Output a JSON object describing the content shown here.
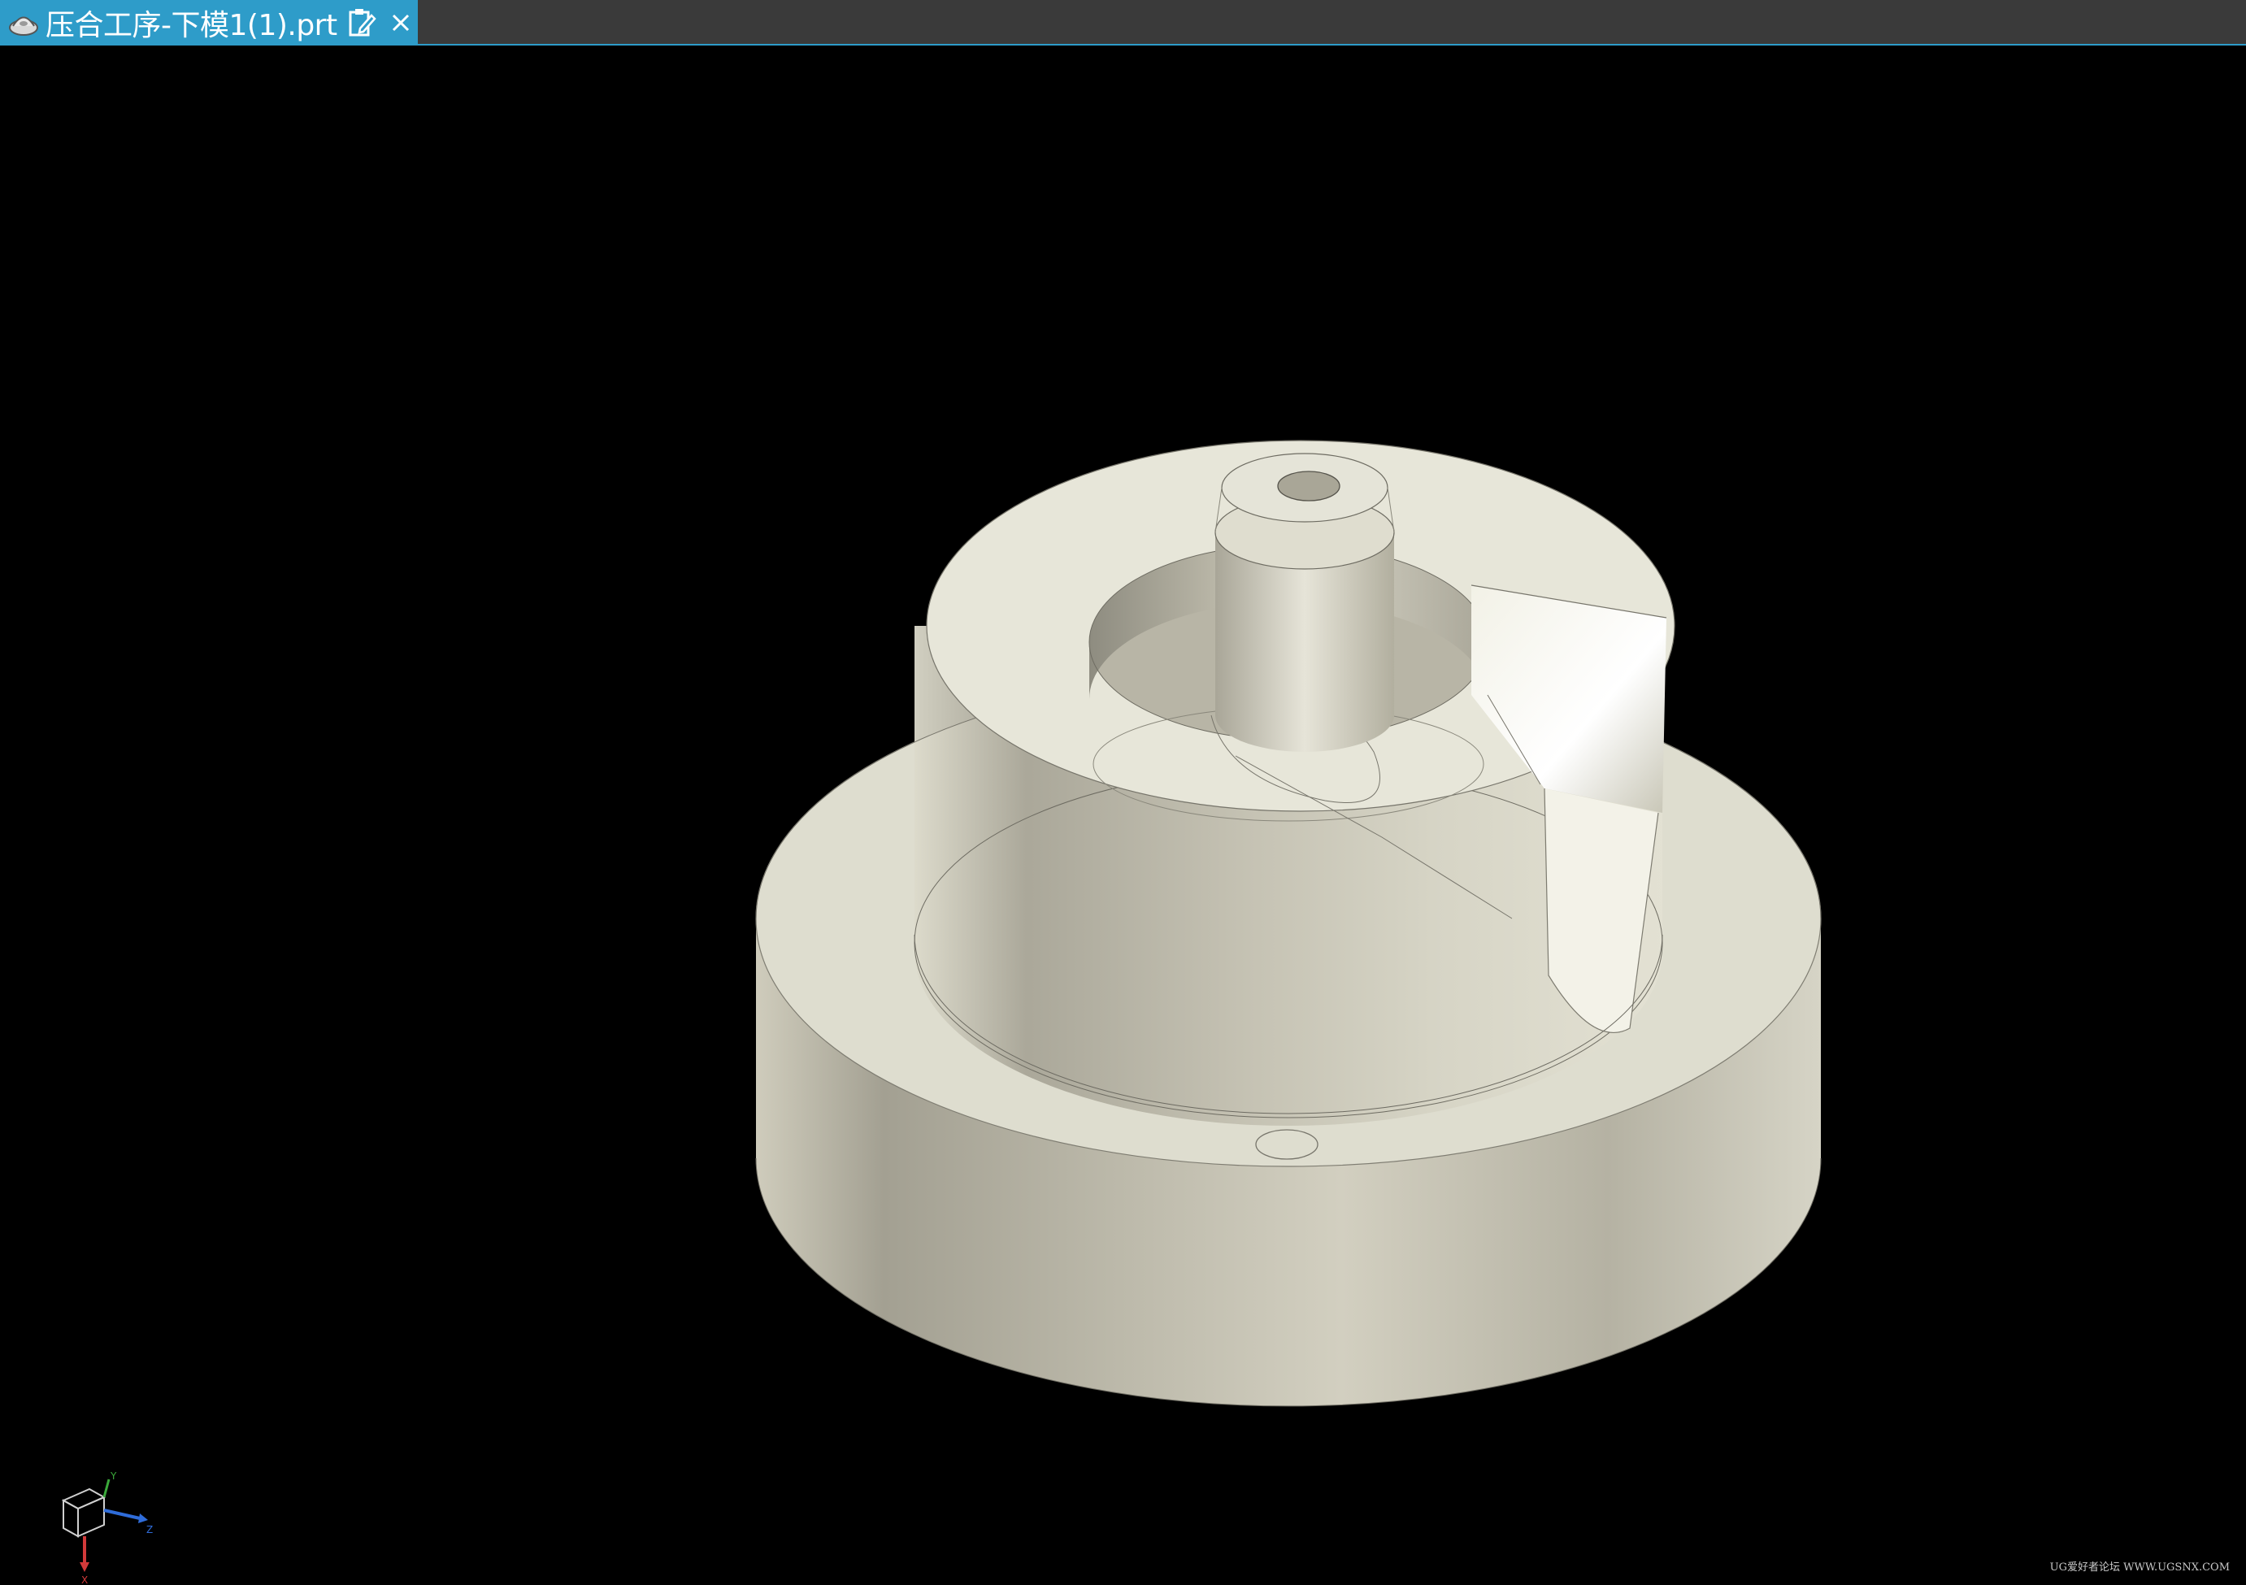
{
  "tab": {
    "title": "压合工序-下模1(1).prt",
    "icon": "part-file-icon",
    "edit_icon": "edit-document-icon",
    "close_icon": "close-icon"
  },
  "viewport": {
    "background": "#000000",
    "model_color": "#d8d6c6",
    "watermark": "UG爱好者论坛 WWW.UGSNX.COM"
  },
  "triad": {
    "x_label": "X",
    "y_label": "Y",
    "z_label": "Z"
  }
}
